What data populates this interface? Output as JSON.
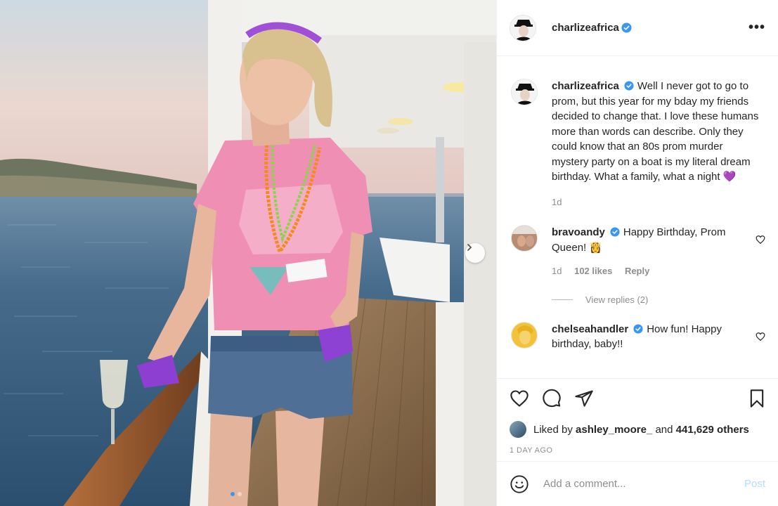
{
  "post": {
    "author": "charlizeafrica",
    "more_label": "•••"
  },
  "caption": {
    "username": "charlizeafrica",
    "text": "Well I never got to go to prom, but this year for my bday my friends decided to change that. I love these humans more than words can describe. Only they could know that an 80s prom murder mystery party on a boat is my literal dream birthday. What a family, what a night 💜",
    "time": "1d"
  },
  "comments": [
    {
      "username": "bravoandy",
      "text": "Happy Birthday, Prom Queen! 👸",
      "time": "1d",
      "likes": "102 likes",
      "reply_label": "Reply",
      "view_replies": "View replies (2)"
    },
    {
      "username": "chelseahandler",
      "text": "How fun! Happy birthday, baby!!"
    }
  ],
  "likes": {
    "prefix": "Liked by",
    "user": "ashley_moore_",
    "middle": "and",
    "count": "441,629 others"
  },
  "timestamp": "1 DAY AGO",
  "add_comment": {
    "placeholder": "Add a comment...",
    "post_label": "Post"
  },
  "carousel": {
    "total_slides": 2,
    "active_slide": 1
  },
  "colors": {
    "verified": "#3897f0",
    "post_disabled": "#b2dffc",
    "muted": "#8e8e8e"
  }
}
